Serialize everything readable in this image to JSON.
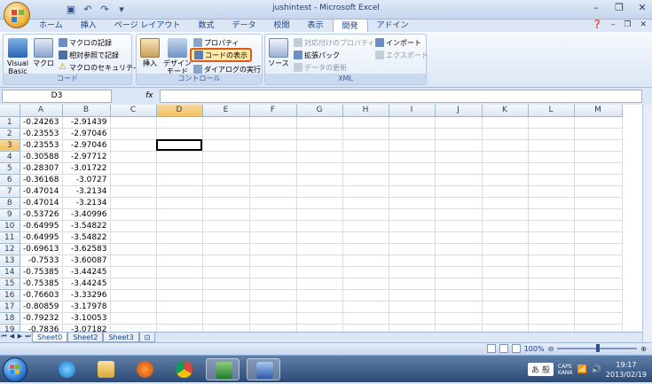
{
  "window": {
    "title": "jushintest - Microsoft Excel",
    "quick_access_icons": [
      "save-icon",
      "undo-icon",
      "redo-icon",
      "customize-icon"
    ]
  },
  "ribbon_tabs": [
    "ホーム",
    "挿入",
    "ページ レイアウト",
    "数式",
    "データ",
    "校閲",
    "表示",
    "開発",
    "アドイン"
  ],
  "active_tab": "開発",
  "ribbon": {
    "code": {
      "label": "コード",
      "visual_basic": "Visual\nBasic",
      "macro": "マクロ",
      "record_macro": "マクロの記録",
      "relative_ref": "相対参照で記録",
      "macro_security": "マクロのセキュリティ"
    },
    "controls": {
      "label": "コントロール",
      "insert": "挿入",
      "design_mode": "デザイン\nモード",
      "properties": "プロパティ",
      "view_code": "コードの表示",
      "run_dialog": "ダイアログの実行"
    },
    "xml": {
      "label": "XML",
      "source": "ソース",
      "map_properties": "対応付けのプロパティ",
      "expansion_packs": "拡張パック",
      "refresh_data": "データの更新",
      "import": "インポート",
      "export": "エクスポート"
    }
  },
  "formula_bar": {
    "name_box": "D3",
    "fx": "fx",
    "value": ""
  },
  "grid": {
    "columns": [
      "A",
      "B",
      "C",
      "D",
      "E",
      "F",
      "G",
      "H",
      "I",
      "J",
      "K",
      "L",
      "M"
    ],
    "active_cell": "D3",
    "rows": [
      [
        "1",
        "-0.24263",
        "-2.91439"
      ],
      [
        "2",
        "-0.23553",
        "-2.97046"
      ],
      [
        "3",
        "-0.23553",
        "-2.97046"
      ],
      [
        "4",
        "-0.30588",
        "-2.97712"
      ],
      [
        "5",
        "-0.28307",
        "-3.01722"
      ],
      [
        "6",
        "-0.36168",
        "-3.0727"
      ],
      [
        "7",
        "-0.47014",
        "-3.2134"
      ],
      [
        "8",
        "-0.47014",
        "-3.2134"
      ],
      [
        "9",
        "-0.53726",
        "-3.40996"
      ],
      [
        "10",
        "-0.64995",
        "-3.54822"
      ],
      [
        "11",
        "-0.64995",
        "-3.54822"
      ],
      [
        "12",
        "-0.69613",
        "-3.62583"
      ],
      [
        "13",
        "-0.7533",
        "-3.60087"
      ],
      [
        "14",
        "-0.75385",
        "-3.44245"
      ],
      [
        "15",
        "-0.75385",
        "-3.44245"
      ],
      [
        "16",
        "-0.76603",
        "-3.33296"
      ],
      [
        "17",
        "-0.80859",
        "-3.17978"
      ],
      [
        "18",
        "-0.79232",
        "-3.10053"
      ],
      [
        "19",
        "-0.7836",
        "-3.07182"
      ]
    ]
  },
  "sheet_tabs": [
    "Sheet0",
    "Sheet2",
    "Sheet3"
  ],
  "active_sheet": "Sheet0",
  "status": {
    "zoom": "100%"
  },
  "taskbar": {
    "apps": [
      "internet-explorer",
      "file-explorer",
      "media-player",
      "chrome",
      "excel",
      "word"
    ],
    "ime": "あ 般",
    "caps": "CAPS\nKANA",
    "time": "19:17",
    "date": "2013/02/19"
  },
  "colors": {
    "highlight_border": "#e25a1a",
    "selected_header": "#f1c15f"
  }
}
